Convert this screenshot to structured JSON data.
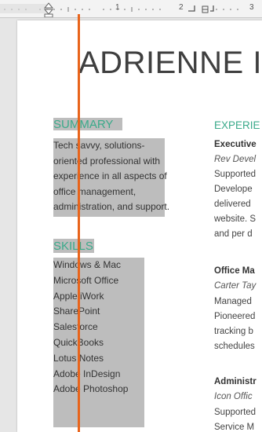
{
  "ruler": {
    "labels": [
      "1",
      "2",
      "3"
    ]
  },
  "name": "ADRIENNE I",
  "summary": {
    "heading": "SUMMARY",
    "lines": [
      "Tech savvy, solutions-",
      "oriented professional with",
      "experience in all aspects of",
      "office management,",
      "administration, and support."
    ]
  },
  "skills": {
    "heading": "SKILLS",
    "items": [
      "Windows & Mac",
      "Microsoft Office",
      "Apple iWork",
      "SharePoint",
      "Salesforce",
      "QuickBooks",
      "Lotus Notes",
      "Adobe InDesign",
      "Adobe Photoshop"
    ]
  },
  "experience": {
    "heading": "EXPERIE",
    "entries": [
      {
        "title": "Executive",
        "company": "Rev Devel",
        "lines": [
          "Supported",
          "Develope",
          "delivered",
          "website. S",
          "and per d"
        ]
      },
      {
        "title": "Office Ma",
        "company": "Carter Tay",
        "lines": [
          "Managed",
          "Pioneered",
          "tracking b",
          "schedules"
        ]
      },
      {
        "title": "Administr",
        "company": "Icon Offic",
        "lines": [
          "Supported",
          "Service M"
        ]
      }
    ]
  },
  "colors": {
    "accent": "#3aaa8a",
    "selection": "#b6b6b6",
    "cursor_line": "#e8641b"
  }
}
